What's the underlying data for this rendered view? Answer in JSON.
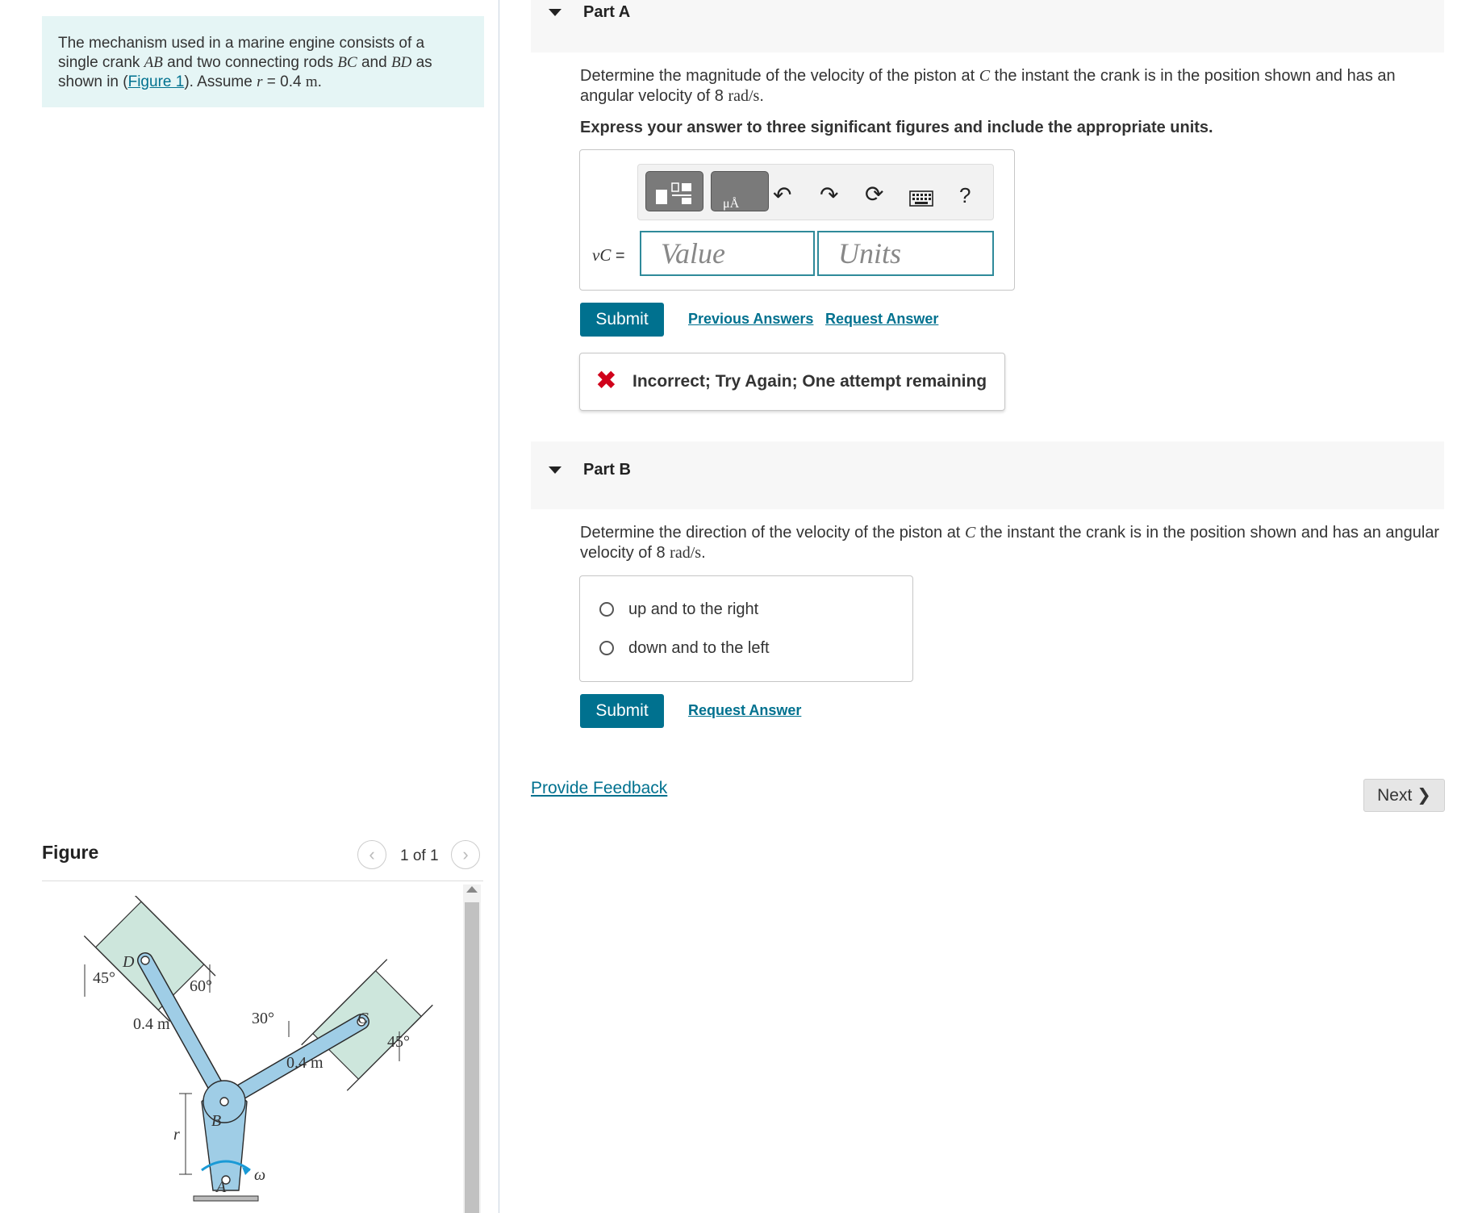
{
  "problem": {
    "text_1": "The mechanism used in a marine engine consists of a single crank ",
    "var_ab": "AB",
    "text_2": " and two connecting rods ",
    "var_bc": "BC",
    "text_3": " and ",
    "var_bd": "BD",
    "text_4": " as shown in (",
    "figure_link": "Figure 1",
    "text_5": "). Assume ",
    "var_r": "r",
    "text_6": " = 0.4 ",
    "unit_m": "m",
    "text_7": "."
  },
  "figure": {
    "title": "Figure",
    "counter": "1 of 1",
    "prev_icon": "chevron-left-icon",
    "next_icon": "chevron-right-icon",
    "labels": {
      "d": "D",
      "c": "C",
      "b": "B",
      "a": "A",
      "ang_left": "45°",
      "ang_60": "60°",
      "ang_30": "30°",
      "ang_right": "45°",
      "len_left": "0.4 m",
      "len_right": "0.4 m",
      "r": "r",
      "omega": "ω"
    }
  },
  "partA": {
    "title": "Part A",
    "question_1": "Determine the magnitude of the velocity of the piston at ",
    "var_c": "C",
    "question_2": " the instant the crank is in the position shown and has an angular velocity of 8 ",
    "unit": "rad/s",
    "question_3": ".",
    "instruction": "Express your answer to three significant figures and include the appropriate units.",
    "toolbar": {
      "templates_icon": "templates-icon",
      "units_icon": "units-icon",
      "undo_icon": "undo-icon",
      "redo_icon": "redo-icon",
      "reset_icon": "reset-icon",
      "keyboard_icon": "keyboard-icon",
      "help_label": "?"
    },
    "answer_label_var": "vC",
    "answer_label_eq": " =",
    "value_placeholder": "Value",
    "units_placeholder": "Units",
    "submit_label": "Submit",
    "previous_answers_label": "Previous Answers",
    "request_answer_label": "Request Answer",
    "feedback_icon": "close-icon",
    "feedback_text": "Incorrect; Try Again; One attempt remaining"
  },
  "partB": {
    "title": "Part B",
    "question_1": "Determine the direction of the velocity of the piston at ",
    "var_c": "C",
    "question_2": " the instant the crank is in the position shown and has an angular velocity of 8 ",
    "unit": "rad/s",
    "question_3": ".",
    "choices": [
      "up and to the right",
      "down and to the left"
    ],
    "submit_label": "Submit",
    "request_answer_label": "Request Answer"
  },
  "footer": {
    "provide_feedback": "Provide Feedback",
    "next_label": "Next",
    "next_icon": "chevron-right-icon"
  },
  "colors": {
    "accent": "#00718f",
    "problem_bg": "#e5f5f5",
    "error": "#d0021b",
    "figure_body": "#9fcde6",
    "figure_cylinder": "#cde6dc"
  }
}
